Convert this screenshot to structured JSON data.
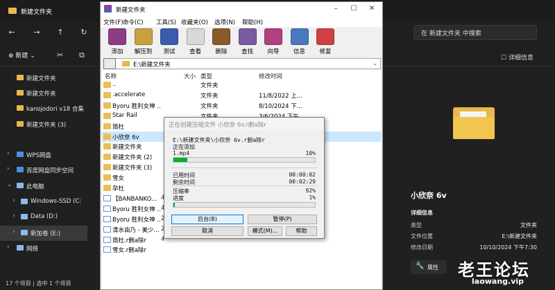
{
  "explorer": {
    "tab_title": "新建文件夹",
    "search_placeholder": "在 新建文件夹 中搜索",
    "new_label": "新建",
    "details_label": "详细信息",
    "sidebar": [
      {
        "label": "新建文件夹",
        "kind": "folder"
      },
      {
        "label": "新建文件夹",
        "kind": "folder"
      },
      {
        "label": "kanojodori v18 合集",
        "kind": "folder"
      },
      {
        "label": "新建文件夹 (3)",
        "kind": "folder"
      },
      {
        "label": "WPS网盘",
        "kind": "cloud"
      },
      {
        "label": "百度网盘同步空间",
        "kind": "cloud"
      },
      {
        "label": "此电脑",
        "kind": "pc"
      },
      {
        "label": "Windows-SSD (C:",
        "kind": "drive"
      },
      {
        "label": "Data (D:)",
        "kind": "drive"
      },
      {
        "label": "新加卷 (E:)",
        "kind": "drive"
      },
      {
        "label": "网络",
        "kind": "network"
      }
    ],
    "status": "17 个项目  |  选中 1 个项目",
    "details": {
      "name": "小欣奈 6v",
      "section": "详细信息",
      "rows": [
        {
          "k": "类型",
          "v": "文件夹"
        },
        {
          "k": "文件位置",
          "v": "E:\\新建文件夹"
        },
        {
          "k": "修改日期",
          "v": "10/10/2024 下午7:30"
        }
      ],
      "properties": "属性"
    },
    "watermark": "老王论坛",
    "watermark_url": "laowang.vip"
  },
  "winrar": {
    "title": "新建文件夹",
    "menu": [
      "文件(F)",
      "命令(C)",
      "工具(S)",
      "收藏夹(O)",
      "选项(N)",
      "帮助(H)"
    ],
    "toolbar": [
      {
        "label": "添加",
        "color": "#8e3c8a"
      },
      {
        "label": "解压到",
        "color": "#c8a040"
      },
      {
        "label": "测试",
        "color": "#3a5cab"
      },
      {
        "label": "查看",
        "color": "#d8d8d8"
      },
      {
        "label": "删除",
        "color": "#8a5a2a"
      },
      {
        "label": "查找",
        "color": "#7a5ba0"
      },
      {
        "label": "向导",
        "color": "#b04080"
      },
      {
        "label": "信息",
        "color": "#4a78c0"
      },
      {
        "label": "修复",
        "color": "#d04040"
      }
    ],
    "path": "E:\\新建文件夹",
    "headers": {
      "name": "名称",
      "size": "大小",
      "type": "类型",
      "date": "修改时间"
    },
    "rows": [
      {
        "name": "..",
        "type": "文件夹",
        "date": "",
        "size": "",
        "file": false
      },
      {
        "name": ".accelerate",
        "type": "文件夹",
        "date": "11/8/2022 上...",
        "size": "",
        "file": false
      },
      {
        "name": "Byoru 胜利女神 ...",
        "type": "文件夹",
        "date": "8/10/2024 下...",
        "size": "",
        "file": false
      },
      {
        "name": "Star Rail",
        "type": "文件夹",
        "date": "3/6/2024 下午...",
        "size": "",
        "file": false
      },
      {
        "name": "简杜",
        "type": "",
        "date": "",
        "size": "",
        "file": false
      },
      {
        "name": "小欣奈 6v",
        "type": "",
        "date": "",
        "size": "",
        "file": false
      },
      {
        "name": "新建文件夹",
        "type": "",
        "date": "",
        "size": "",
        "file": false
      },
      {
        "name": "新建文件夹 (2)",
        "type": "",
        "date": "",
        "size": "",
        "file": false
      },
      {
        "name": "新建文件夹 (3)",
        "type": "",
        "date": "",
        "size": "",
        "file": false
      },
      {
        "name": "雪女",
        "type": "",
        "date": "",
        "size": "",
        "file": false
      },
      {
        "name": "孕杜",
        "type": "",
        "date": "",
        "size": "",
        "file": false
      },
      {
        "name": "【BANBANKO...",
        "type": "",
        "date": "",
        "size": "4",
        "file": true
      },
      {
        "name": "Byoru 胜利女神 ...",
        "type": "",
        "date": "",
        "size": "4",
        "file": true
      },
      {
        "name": "Byoru 胜利女神 ...",
        "type": "",
        "date": "",
        "size": "2",
        "file": true
      },
      {
        "name": "清水由乃 - 美少...",
        "type": "",
        "date": "",
        "size": "2",
        "file": true
      },
      {
        "name": "简杜.r删a除r",
        "type": "",
        "date": "",
        "size": "4",
        "file": true
      },
      {
        "name": "雪女.r删a除r",
        "type": "",
        "date": "",
        "size": "",
        "file": true
      }
    ]
  },
  "dialog": {
    "title": "正在创建压缩文件 小欣奈 6v.r删a除r",
    "archive": "E:\\新建文件夹\\小欣奈 6v.r删a除r",
    "adding": "正在添加",
    "file": "1.mp4",
    "file_pct": "10%",
    "file_progress": 10,
    "elapsed_label": "已用时间",
    "elapsed": "00:00:02",
    "remain_label": "剩余时间",
    "remain": "00:02:29",
    "ratio_label": "压缩率",
    "ratio": "92%",
    "progress_label": "进度",
    "progress_pct": "1%",
    "total_progress": 1,
    "buttons": {
      "background": "后台(B)",
      "pause": "暂停(P)",
      "cancel": "取消",
      "mode": "模式(M)...",
      "help": "帮助"
    }
  }
}
